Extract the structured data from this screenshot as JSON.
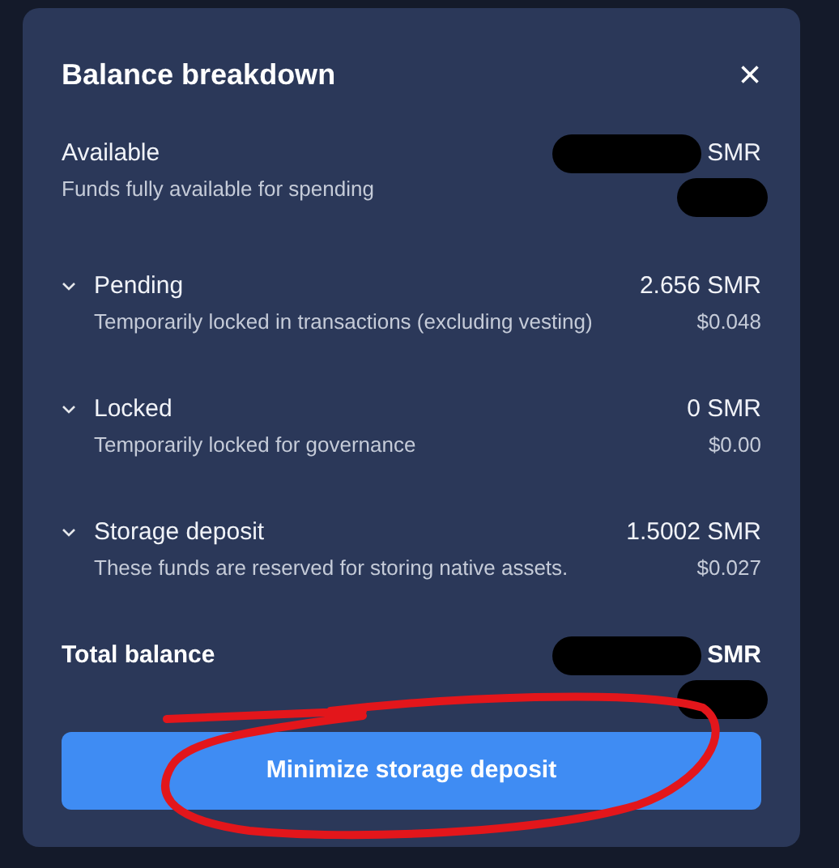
{
  "dialog": {
    "title": "Balance breakdown",
    "close": "×"
  },
  "sections": [
    {
      "kind": "plain",
      "label": "Available",
      "description": "Funds fully available for spending",
      "amount": "SMR",
      "amount_redacted": true,
      "fiat_redacted": true
    },
    {
      "kind": "expandable",
      "label": "Pending",
      "description": "Temporarily locked in transactions (excluding vesting)",
      "amount": "2.656 SMR",
      "fiat": "$0.048"
    },
    {
      "kind": "expandable",
      "label": "Locked",
      "description": "Temporarily locked for governance",
      "amount": "0 SMR",
      "fiat": "$0.00"
    },
    {
      "kind": "expandable",
      "label": "Storage deposit",
      "description": "These funds are reserved for storing native assets.",
      "amount": "1.5002 SMR",
      "fiat": "$0.027"
    },
    {
      "kind": "total",
      "label": "Total balance",
      "amount": "SMR",
      "amount_redacted": true,
      "fiat_redacted": true
    }
  ],
  "button": {
    "label": "Minimize storage deposit"
  },
  "annotation": {
    "kind": "circle"
  }
}
